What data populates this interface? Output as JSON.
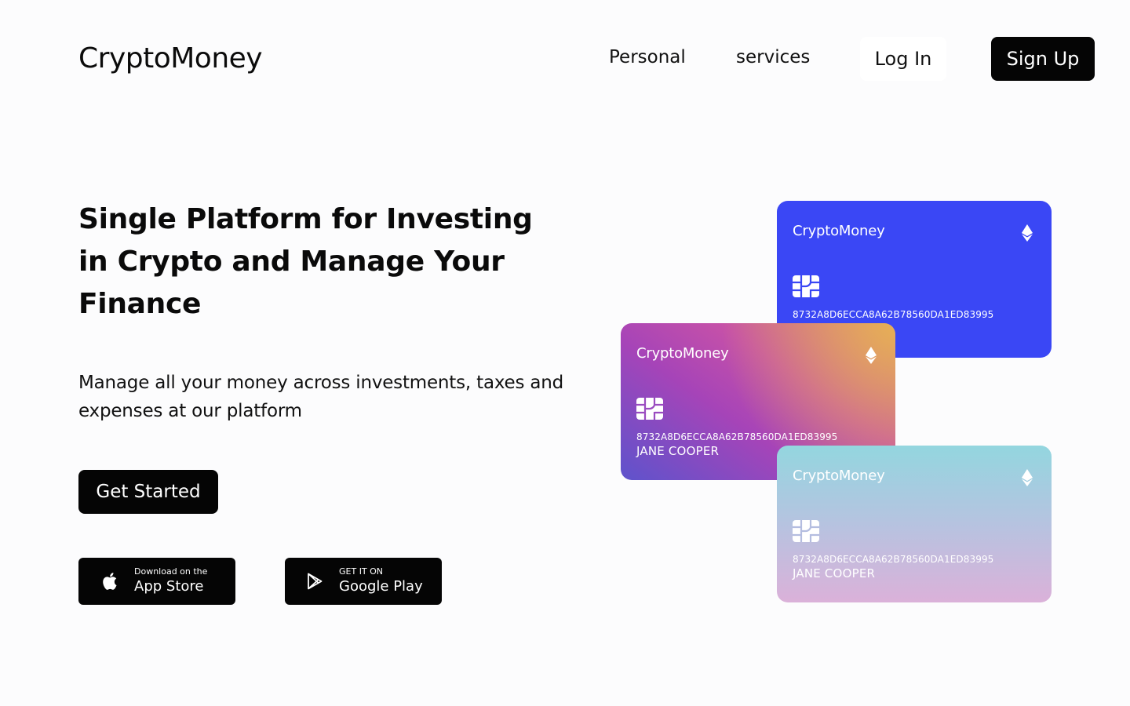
{
  "header": {
    "logo": "CryptoMoney",
    "nav": {
      "personal": "Personal",
      "services": "services"
    },
    "login_label": "Log In",
    "signup_label": "Sign Up"
  },
  "hero": {
    "title": "Single Platform for Investing in Crypto and Manage Your Finance",
    "subtitle": "Manage all your money across investments, taxes and expenses at our platform",
    "cta_label": "Get Started"
  },
  "stores": {
    "apple": {
      "small": "Download on the",
      "big": "App Store",
      "icon": "apple-icon"
    },
    "google": {
      "small": "GET IT ON",
      "big": "Google Play",
      "icon": "google-play-icon"
    }
  },
  "cards": [
    {
      "brand": "CryptoMoney",
      "number": "8732A8D6ECCA8A62B78560DA1ED83995",
      "holder": "",
      "icons": [
        "ethereum-icon",
        "chip-icon"
      ],
      "color": "#3a47f5"
    },
    {
      "brand": "CryptoMoney",
      "number": "8732A8D6ECCA8A62B78560DA1ED83995",
      "holder": "JANE COOPER",
      "icons": [
        "ethereum-icon",
        "chip-icon"
      ],
      "colors": [
        "#5e53cc",
        "#c651a8",
        "#e7b254"
      ]
    },
    {
      "brand": "CryptoMoney",
      "number": "8732A8D6ECCA8A62B78560DA1ED83995",
      "holder": "JANE COOPER",
      "icons": [
        "ethereum-icon",
        "chip-icon"
      ],
      "colors": [
        "#93d6df",
        "#dbb1d9"
      ]
    }
  ],
  "colors": {
    "primary": "#050505",
    "background": "#fcfcfd"
  }
}
